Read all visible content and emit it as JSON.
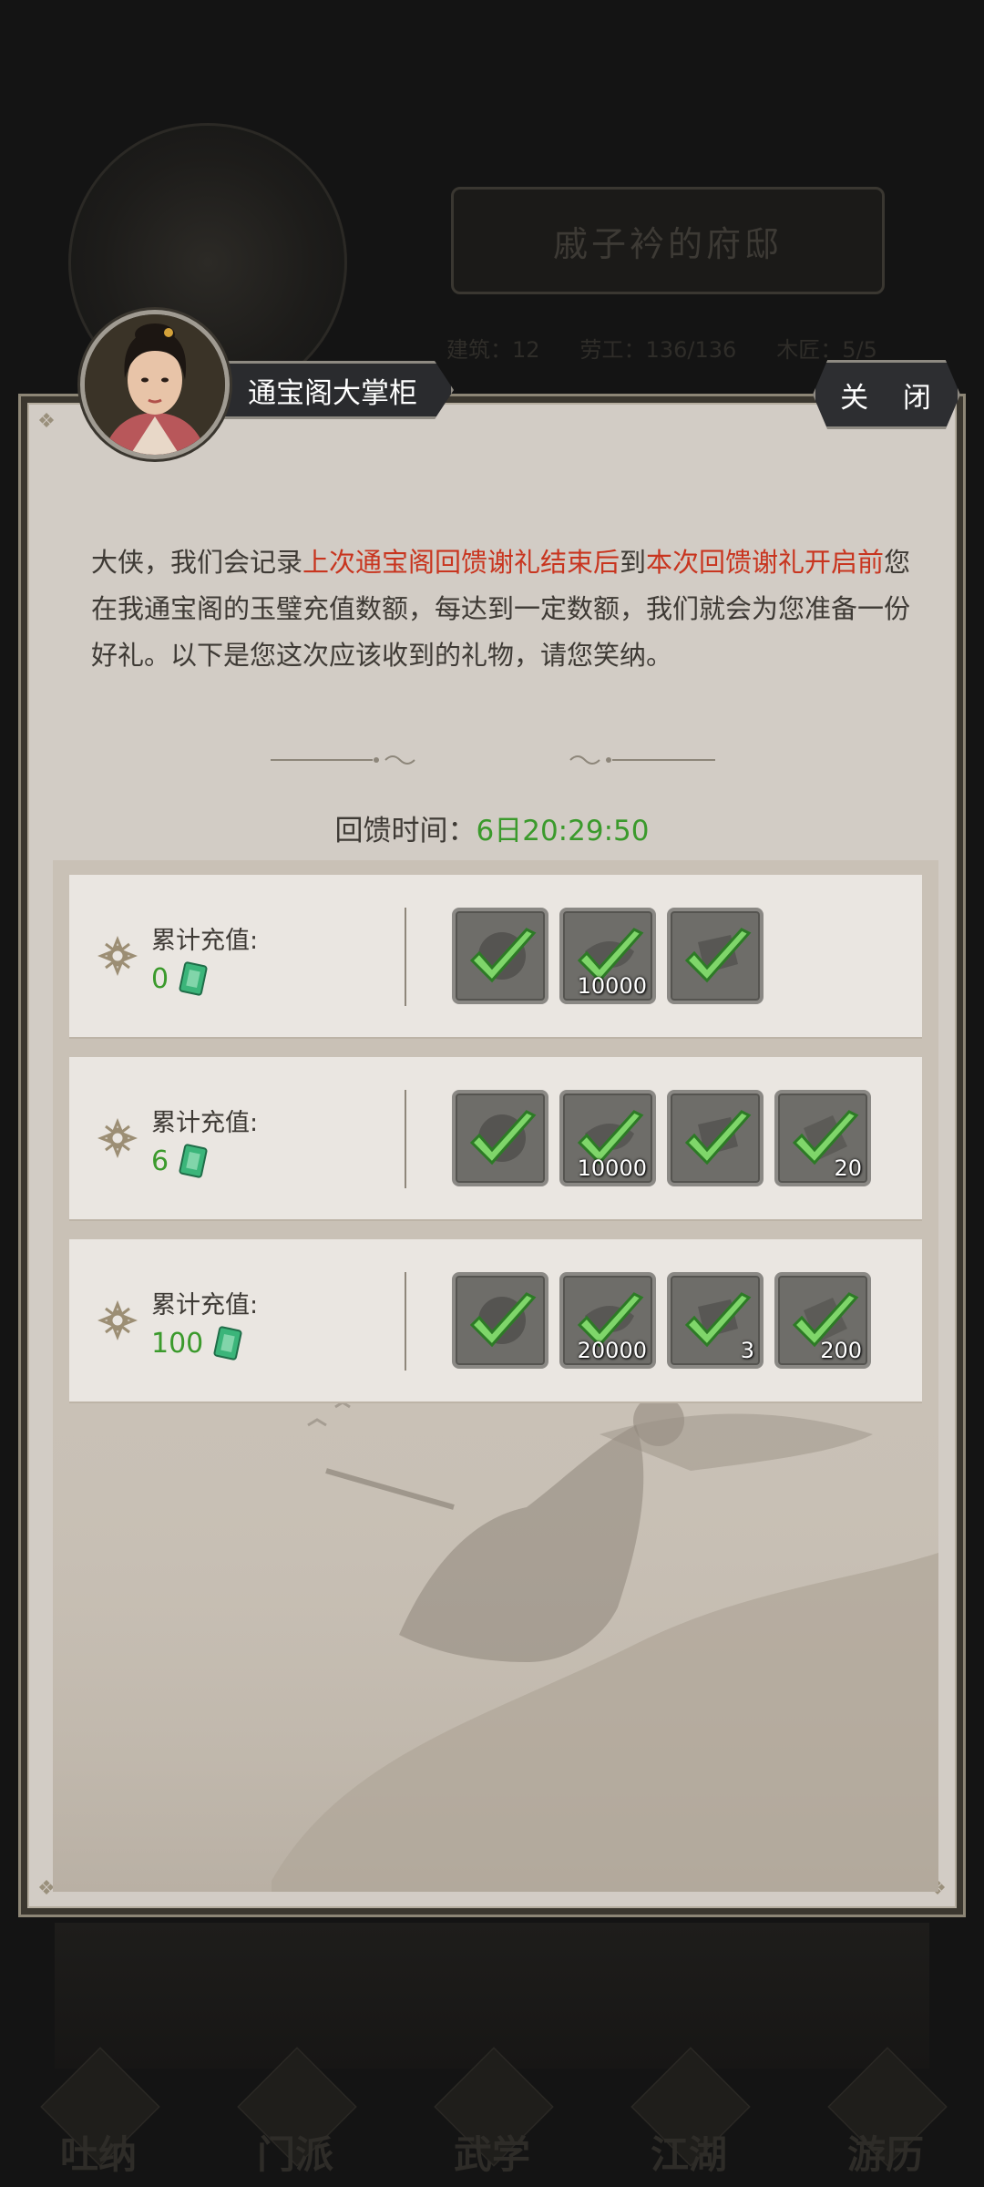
{
  "background": {
    "mansion_title": "戚子衿的府邸",
    "stats": [
      "建筑：12",
      "劳工：136/136",
      "木匠：5/5"
    ],
    "nav": [
      "吐纳",
      "门派",
      "武学",
      "江湖",
      "游历"
    ]
  },
  "dialog": {
    "npc_name": "通宝阁大掌柜",
    "close_label": "关 闭",
    "intro": {
      "p1": "大侠，我们会记录",
      "r1": "上次通宝阁回馈谢礼结束后",
      "p2": "到",
      "r2": "本次回馈谢礼开启前",
      "p3": "您在我通宝阁的玉璧充值数额，每达到一定数额，我们就会为您准备一份好礼。以下是您这次应该收到的礼物，请您笑纳。"
    },
    "timer_label": "回馈时间：",
    "timer_value": "6日20:29:50",
    "rows": [
      {
        "label": "累计充值:",
        "amount": "0",
        "items": [
          {
            "icon": "token-icon",
            "qty": ""
          },
          {
            "icon": "silver-ingot-icon",
            "qty": "10000"
          },
          {
            "icon": "scroll-icon",
            "qty": ""
          }
        ]
      },
      {
        "label": "累计充值:",
        "amount": "6",
        "items": [
          {
            "icon": "token-icon",
            "qty": ""
          },
          {
            "icon": "silver-ingot-icon",
            "qty": "10000"
          },
          {
            "icon": "scroll-icon",
            "qty": ""
          },
          {
            "icon": "book-icon",
            "qty": "20"
          }
        ]
      },
      {
        "label": "累计充值:",
        "amount": "100",
        "items": [
          {
            "icon": "token-icon",
            "qty": ""
          },
          {
            "icon": "silver-ingot-icon",
            "qty": "20000"
          },
          {
            "icon": "scroll-icon",
            "qty": "3"
          },
          {
            "icon": "book-icon",
            "qty": "200"
          }
        ]
      }
    ],
    "colors": {
      "accent_red": "#c8351f",
      "accent_green": "#3b9a2c",
      "check_green": "#7fd66a"
    }
  }
}
